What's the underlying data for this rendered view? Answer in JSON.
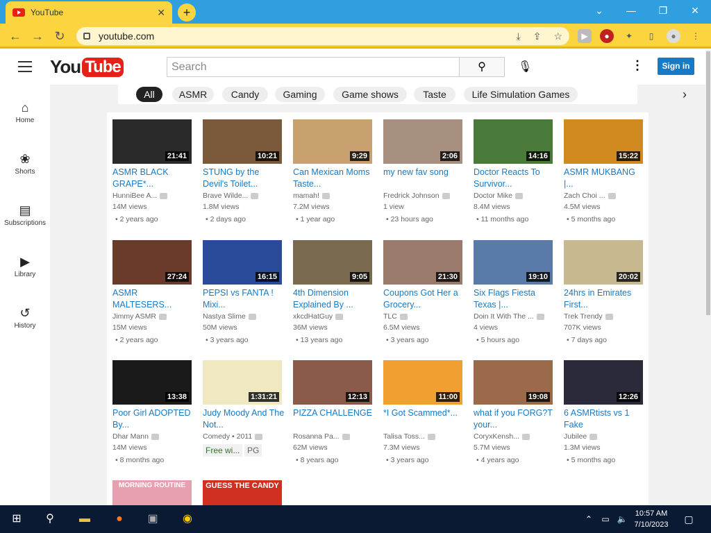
{
  "browser": {
    "tab_title": "YouTube",
    "url": "youtube.com",
    "new_tab_label": "+"
  },
  "youtube": {
    "logo_you": "You",
    "logo_tube": "Tube",
    "search_placeholder": "Search",
    "signin": "Sign in"
  },
  "sidebar": [
    {
      "label": "Home",
      "icon": "home-icon"
    },
    {
      "label": "Shorts",
      "icon": "shorts-icon"
    },
    {
      "label": "Subscriptions",
      "icon": "subscriptions-icon"
    },
    {
      "label": "Library",
      "icon": "library-icon"
    },
    {
      "label": "History",
      "icon": "history-icon"
    }
  ],
  "chips": [
    "All",
    "ASMR",
    "Candy",
    "Gaming",
    "Game shows",
    "Taste",
    "Life Simulation Games"
  ],
  "videos": [
    {
      "title": "ASMR BLACK GRAPE*...",
      "channel": "HunniBee A...",
      "views": "14M views",
      "age": "2 years ago",
      "duration": "21:41",
      "thumb": "#2a2a2a"
    },
    {
      "title": "STUNG by the Devil's Toilet...",
      "channel": "Brave Wilde...",
      "views": "1.8M views",
      "age": "2 days ago",
      "duration": "10:21",
      "thumb": "#7a5a3a"
    },
    {
      "title": "Can Mexican Moms Taste...",
      "channel": "mamah!",
      "views": "7.2M views",
      "age": "1 year ago",
      "duration": "9:29",
      "thumb": "#c9a070"
    },
    {
      "title": "my new fav song",
      "channel": "Fredrick Johnson",
      "views": "1 view",
      "age": "23 hours ago",
      "duration": "2:06",
      "thumb": "#a89080"
    },
    {
      "title": "Doctor Reacts To Survivor...",
      "channel": "Doctor Mike",
      "views": "8.4M views",
      "age": "11 months ago",
      "duration": "14:16",
      "thumb": "#4a7a3a"
    },
    {
      "title": "ASMR MUKBANG |...",
      "channel": "Zach Choi ...",
      "views": "4.5M views",
      "age": "5 months ago",
      "duration": "15:22",
      "thumb": "#d08a20"
    },
    {
      "title": "ASMR MALTESERS...",
      "channel": "Jimmy ASMR",
      "views": "15M views",
      "age": "2 years ago",
      "duration": "27:24",
      "thumb": "#6a3a2a"
    },
    {
      "title": "PEPSI vs FANTA ! Mixi...",
      "channel": "Nastya Slime",
      "views": "50M views",
      "age": "3 years ago",
      "duration": "16:15",
      "thumb": "#2a4a9a"
    },
    {
      "title": "4th Dimension Explained By ...",
      "channel": "xkcdHatGuy",
      "views": "36M views",
      "age": "13 years ago",
      "duration": "9:05",
      "thumb": "#7a6a50"
    },
    {
      "title": "Coupons Got Her a Grocery...",
      "channel": "TLC",
      "views": "6.5M views",
      "age": "3 years ago",
      "duration": "21:30",
      "thumb": "#9a7a6a"
    },
    {
      "title": "Six Flags Fiesta Texas |...",
      "channel": "Doin It With The ...",
      "views": "4 views",
      "age": "5 hours ago",
      "duration": "19:10",
      "thumb": "#5a7aaa"
    },
    {
      "title": "24hrs in Emirates First...",
      "channel": "Trek Trendy",
      "views": "707K views",
      "age": "7 days ago",
      "duration": "20:02",
      "thumb": "#c8b890"
    },
    {
      "title": "Poor Girl ADOPTED By...",
      "channel": "Dhar Mann",
      "views": "14M views",
      "age": "8 months ago",
      "duration": "13:38",
      "thumb": "#1a1a1a"
    },
    {
      "title": "Judy Moody And The Not...",
      "channel": "Comedy • 2011",
      "views": "",
      "age": "",
      "duration": "1:31:21",
      "thumb": "#f0e8c0",
      "free": "Free wi...",
      "rating": "PG"
    },
    {
      "title": "PIZZA CHALLENGE",
      "channel": "Rosanna Pa...",
      "views": "62M views",
      "age": "8 years ago",
      "duration": "12:13",
      "thumb": "#8a5a4a"
    },
    {
      "title": "*I Got Scammed*...",
      "channel": "Talisa Toss...",
      "views": "7.3M views",
      "age": "3 years ago",
      "duration": "11:00",
      "thumb": "#f0a030"
    },
    {
      "title": "what if you FORG?T your...",
      "channel": "CoryxKensh...",
      "views": "5.7M views",
      "age": "4 years ago",
      "duration": "19:08",
      "thumb": "#9a6a4a"
    },
    {
      "title": "6 ASMRtists vs 1 Fake",
      "channel": "Jubilee",
      "views": "1.3M views",
      "age": "5 months ago",
      "duration": "12:26",
      "thumb": "#2a2a3a"
    },
    {
      "title": "",
      "channel": "",
      "views": "",
      "age": "",
      "duration": "",
      "thumb": "#e8a0b0"
    },
    {
      "title": "",
      "channel": "",
      "views": "",
      "age": "",
      "duration": "",
      "thumb": "#d03020"
    }
  ],
  "thumb_text": {
    "row2_guess": "GUESS THE CANDY",
    "morning": "MORNING ROUTINE"
  },
  "taskbar": {
    "time": "10:57 AM",
    "date": "7/10/2023"
  }
}
